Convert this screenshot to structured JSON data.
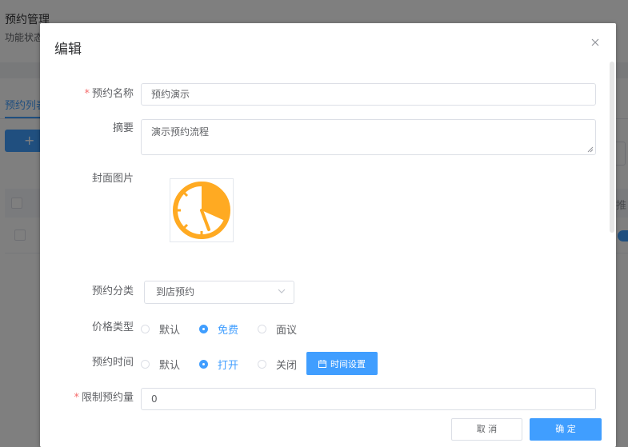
{
  "background": {
    "page_title": "预约管理",
    "subtitle": "功能状态",
    "tab_label": "预约列表",
    "add_button_label": "+",
    "column_header_partial": "推"
  },
  "dialog": {
    "title": "编辑",
    "close_icon": "close-icon",
    "fields": {
      "name": {
        "label": "预约名称",
        "value": "预约演示",
        "required": true
      },
      "summary": {
        "label": "摘要",
        "value": "演示预约流程"
      },
      "cover": {
        "label": "封面图片",
        "icon": "clock-icon",
        "color": "#ffaa22"
      },
      "category": {
        "label": "预约分类",
        "value": "到店预约"
      },
      "price_type": {
        "label": "价格类型",
        "options": [
          "默认",
          "免费",
          "面议"
        ],
        "selected": "免费"
      },
      "time": {
        "label": "预约时间",
        "options": [
          "默认",
          "打开",
          "关闭"
        ],
        "selected": "打开",
        "button_label": "时间设置"
      },
      "limit": {
        "label": "限制预约量",
        "value": "0",
        "required": true
      }
    },
    "footer": {
      "cancel_label": "取 消",
      "confirm_label": "确 定"
    }
  },
  "colors": {
    "primary": "#409eff",
    "required": "#f56c6c",
    "cover_accent": "#ffaa22"
  }
}
